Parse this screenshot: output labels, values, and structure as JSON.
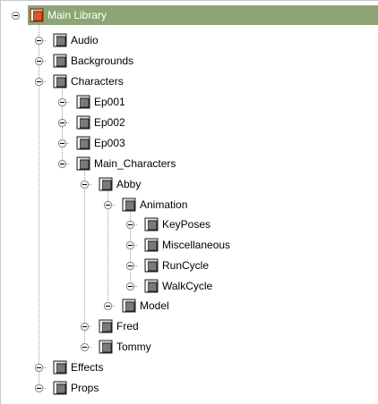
{
  "root": {
    "label": "Main Library"
  },
  "items": {
    "audio": "Audio",
    "backgrounds": "Backgrounds",
    "characters": "Characters",
    "ep001": "Ep001",
    "ep002": "Ep002",
    "ep003": "Ep003",
    "main_characters": "Main_Characters",
    "abby": "Abby",
    "animation": "Animation",
    "keyposes": "KeyPoses",
    "miscellaneous": "Miscellaneous",
    "runcycle": "RunCycle",
    "walkcycle": "WalkCycle",
    "model": "Model",
    "fred": "Fred",
    "tommy": "Tommy",
    "effects": "Effects",
    "props": "Props"
  },
  "icons": {
    "collapse": "minus-box-icon",
    "folder": "folder-icon",
    "root_folder": "library-folder-icon"
  },
  "colors": {
    "selection": "#8ea474",
    "root_folder": "#d55a2a",
    "folder": "#7a7a7a"
  }
}
